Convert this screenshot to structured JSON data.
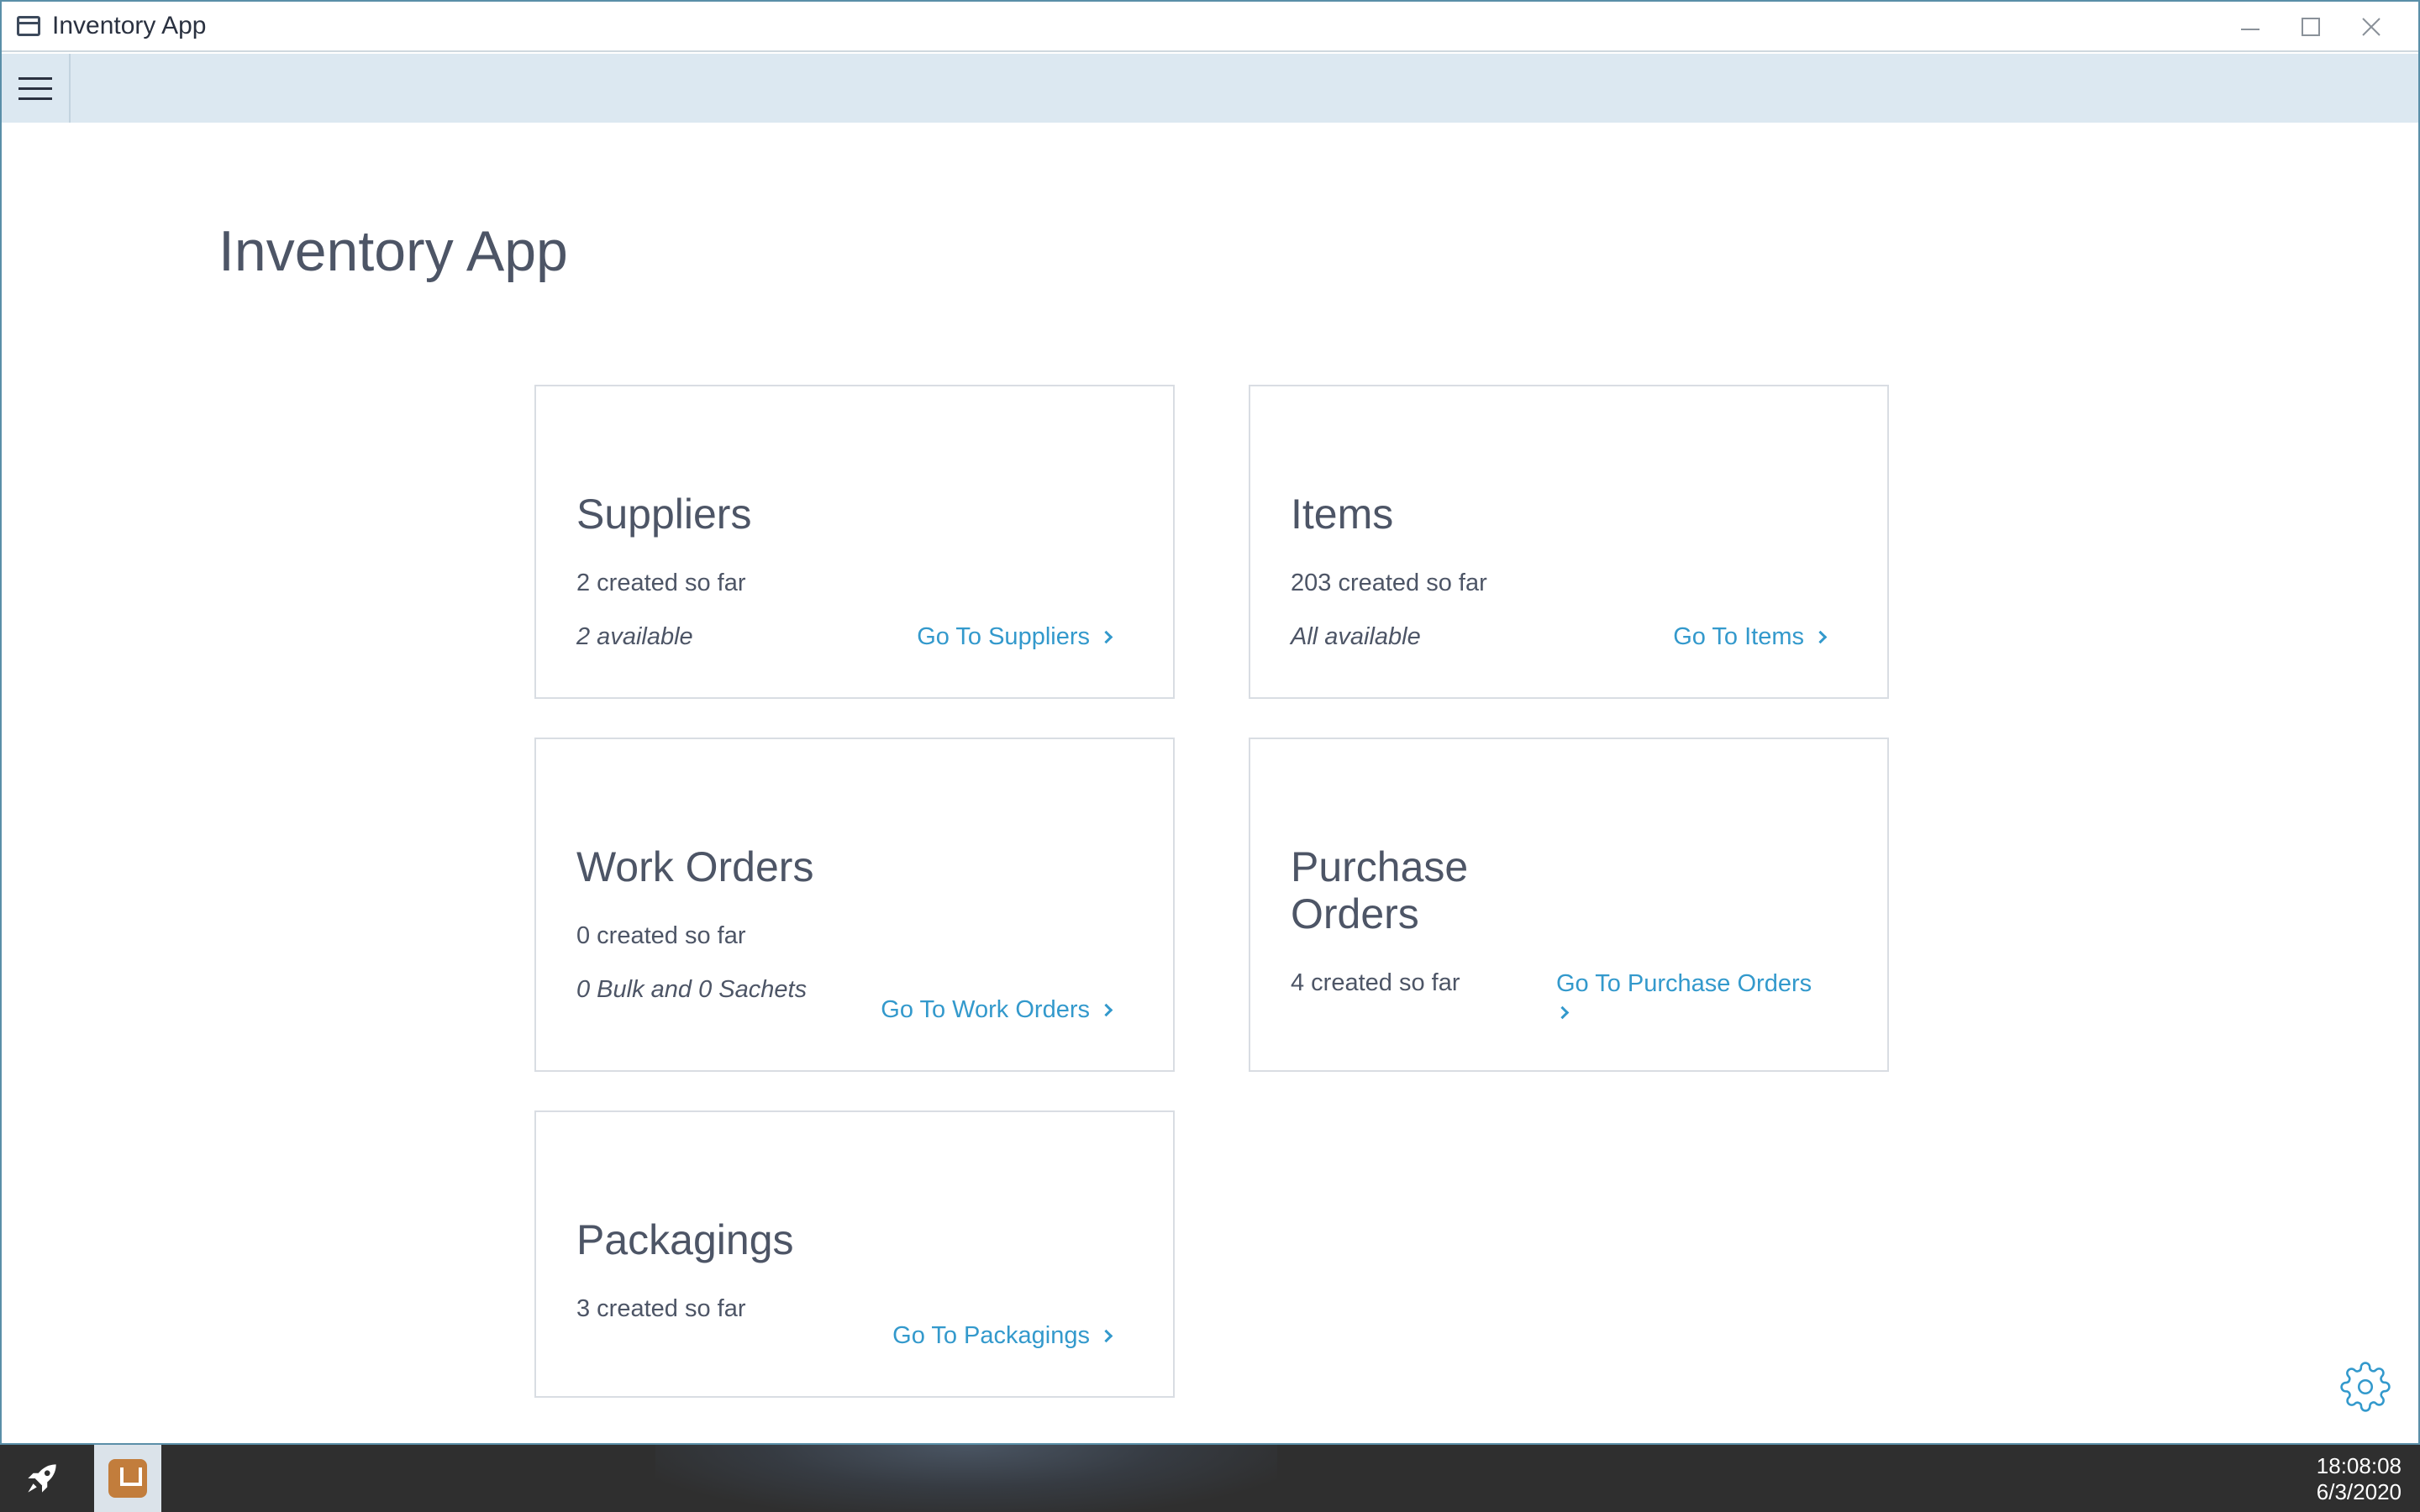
{
  "window": {
    "title": "Inventory App"
  },
  "page": {
    "title": "Inventory App"
  },
  "cards": {
    "suppliers": {
      "title": "Suppliers",
      "count": "2 created so far",
      "status": "2 available",
      "link": "Go To Suppliers"
    },
    "items": {
      "title": "Items",
      "count": "203 created so far",
      "status": "All available",
      "link": "Go To Items"
    },
    "work_orders": {
      "title": "Work Orders",
      "count": "0 created so far",
      "status": "0 Bulk and 0 Sachets",
      "link": "Go To Work Orders"
    },
    "purchase_orders": {
      "title_line1": "Purchase",
      "title_line2": "Orders",
      "count": "4 created so far",
      "link": "Go To Purchase Orders"
    },
    "packagings": {
      "title": "Packagings",
      "count": "3 created so far",
      "link": "Go To Packagings"
    }
  },
  "taskbar": {
    "time": "18:08:08",
    "date": "6/3/2020"
  },
  "colors": {
    "accent": "#3399cc",
    "appbar": "#dce8f1",
    "text": "#4d5566"
  },
  "icons": [
    "window-icon",
    "minimize-icon",
    "maximize-icon",
    "close-icon",
    "hamburger-menu-icon",
    "chevron-right-icon",
    "settings-gear-icon",
    "rocket-launcher-icon",
    "inventory-app-icon"
  ]
}
